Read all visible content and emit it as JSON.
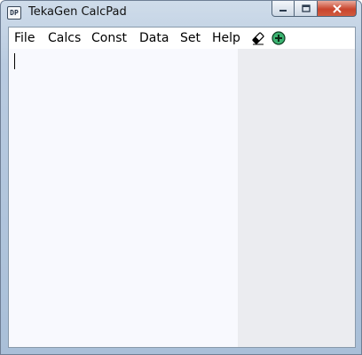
{
  "window": {
    "title": "TekaGen CalcPad",
    "icon": "calcpad-app-icon",
    "icon_text": "DP"
  },
  "caption_buttons": [
    "minimize-icon",
    "maximize-icon",
    "close-icon"
  ],
  "menu": {
    "items": [
      {
        "label": "File"
      },
      {
        "label": "Calcs"
      },
      {
        "label": "Const"
      },
      {
        "label": "Data"
      },
      {
        "label": "Set"
      },
      {
        "label": "Help"
      }
    ]
  },
  "toolbar": {
    "icons": [
      "eraser-icon",
      "add-circle-icon"
    ]
  },
  "editor": {
    "value": ""
  },
  "colors": {
    "editor_bg": "#f8f9fe",
    "panel_bg": "#ebecf0",
    "add_icon": "#3cb371",
    "close_button": "#c9452d"
  }
}
